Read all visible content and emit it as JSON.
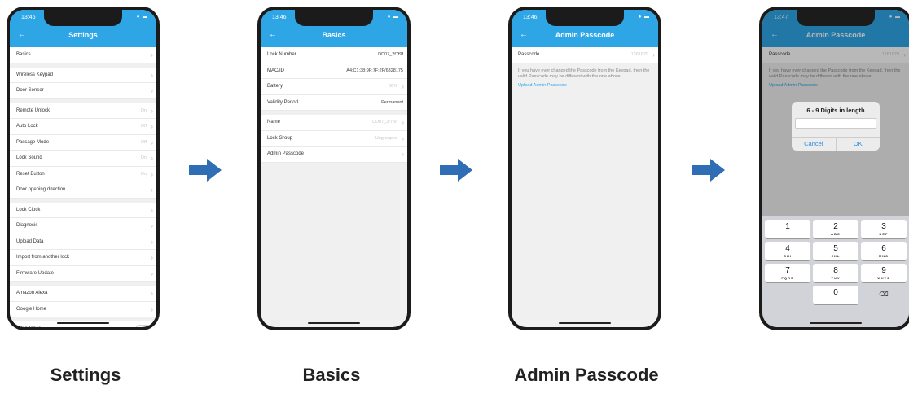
{
  "phones": [
    {
      "time": "13:46",
      "title": "Settings",
      "rows": [
        {
          "label": "Basics"
        },
        {
          "gap": true
        },
        {
          "label": "Wireless Keypad"
        },
        {
          "label": "Door Sensor"
        },
        {
          "gap": true
        },
        {
          "label": "Remote Unlock",
          "value": "On"
        },
        {
          "label": "Auto Lock",
          "value": "Off"
        },
        {
          "label": "Passage Mode",
          "value": "Off"
        },
        {
          "label": "Lock Sound",
          "value": "On"
        },
        {
          "label": "Reset Button",
          "value": "On"
        },
        {
          "label": "Door opening direction"
        },
        {
          "gap": true
        },
        {
          "label": "Lock Clock"
        },
        {
          "label": "Diagnosis"
        },
        {
          "label": "Upload Data"
        },
        {
          "label": "Import from another lock"
        },
        {
          "label": "Firmware Update"
        },
        {
          "gap": true
        },
        {
          "label": "Amazon Alexa"
        },
        {
          "label": "Google Home"
        },
        {
          "gap": true
        },
        {
          "label": "Attendance",
          "toggle": true
        }
      ]
    },
    {
      "time": "13:46",
      "title": "Basics",
      "rows": [
        {
          "label": "Lock Number",
          "value": "DD07_2f7f9f",
          "dark": true,
          "nochev": true
        },
        {
          "label": "MAC/ID",
          "value": "A4:C1:38:9F:7F:2F/6328175",
          "dark": true,
          "nochev": true
        },
        {
          "label": "Battery",
          "value": "86%"
        },
        {
          "label": "Validity Period",
          "value": "Permanent",
          "dark": true,
          "nochev": true
        },
        {
          "gap": true
        },
        {
          "label": "Name",
          "value": "DD07_2f7f9f"
        },
        {
          "label": "Lock Group",
          "value": "Ungrouped"
        },
        {
          "label": "Admin Passcode"
        }
      ]
    },
    {
      "time": "13:46",
      "title": "Admin Passcode",
      "rows": [
        {
          "label": "Passcode",
          "value": "1261679"
        }
      ],
      "info": "If you have ever changed the Passcode from the Keypad, then the valid Passcode may be different with the one above.",
      "link": "Upload Admin Passcode"
    },
    {
      "time": "13:47",
      "title": "Admin Passcode",
      "rows": [
        {
          "label": "Passcode",
          "value": "1261679"
        }
      ],
      "info": "If you have ever changed the Passcode from the Keypad, then the valid Passcode may be different with the one above.",
      "link": "Upload Admin Passcode",
      "dialog": {
        "title": "6 - 9 Digits in length",
        "cancel": "Cancel",
        "ok": "OK"
      },
      "keypad": [
        [
          {
            "n": "1",
            "l": ""
          },
          {
            "n": "2",
            "l": "ABC"
          },
          {
            "n": "3",
            "l": "DEF"
          }
        ],
        [
          {
            "n": "4",
            "l": "GHI"
          },
          {
            "n": "5",
            "l": "JKL"
          },
          {
            "n": "6",
            "l": "MNO"
          }
        ],
        [
          {
            "n": "7",
            "l": "PQRS"
          },
          {
            "n": "8",
            "l": "TUV"
          },
          {
            "n": "9",
            "l": "WXYZ"
          }
        ],
        [
          {
            "blank": true
          },
          {
            "n": "0",
            "l": ""
          },
          {
            "bs": "⌫"
          }
        ]
      ]
    }
  ],
  "captions": [
    "Settings",
    "Basics",
    "Admin Passcode"
  ],
  "colors": {
    "header": "#2ea6e6",
    "arrow": "#2f6db5",
    "link": "#2ea6e6"
  }
}
